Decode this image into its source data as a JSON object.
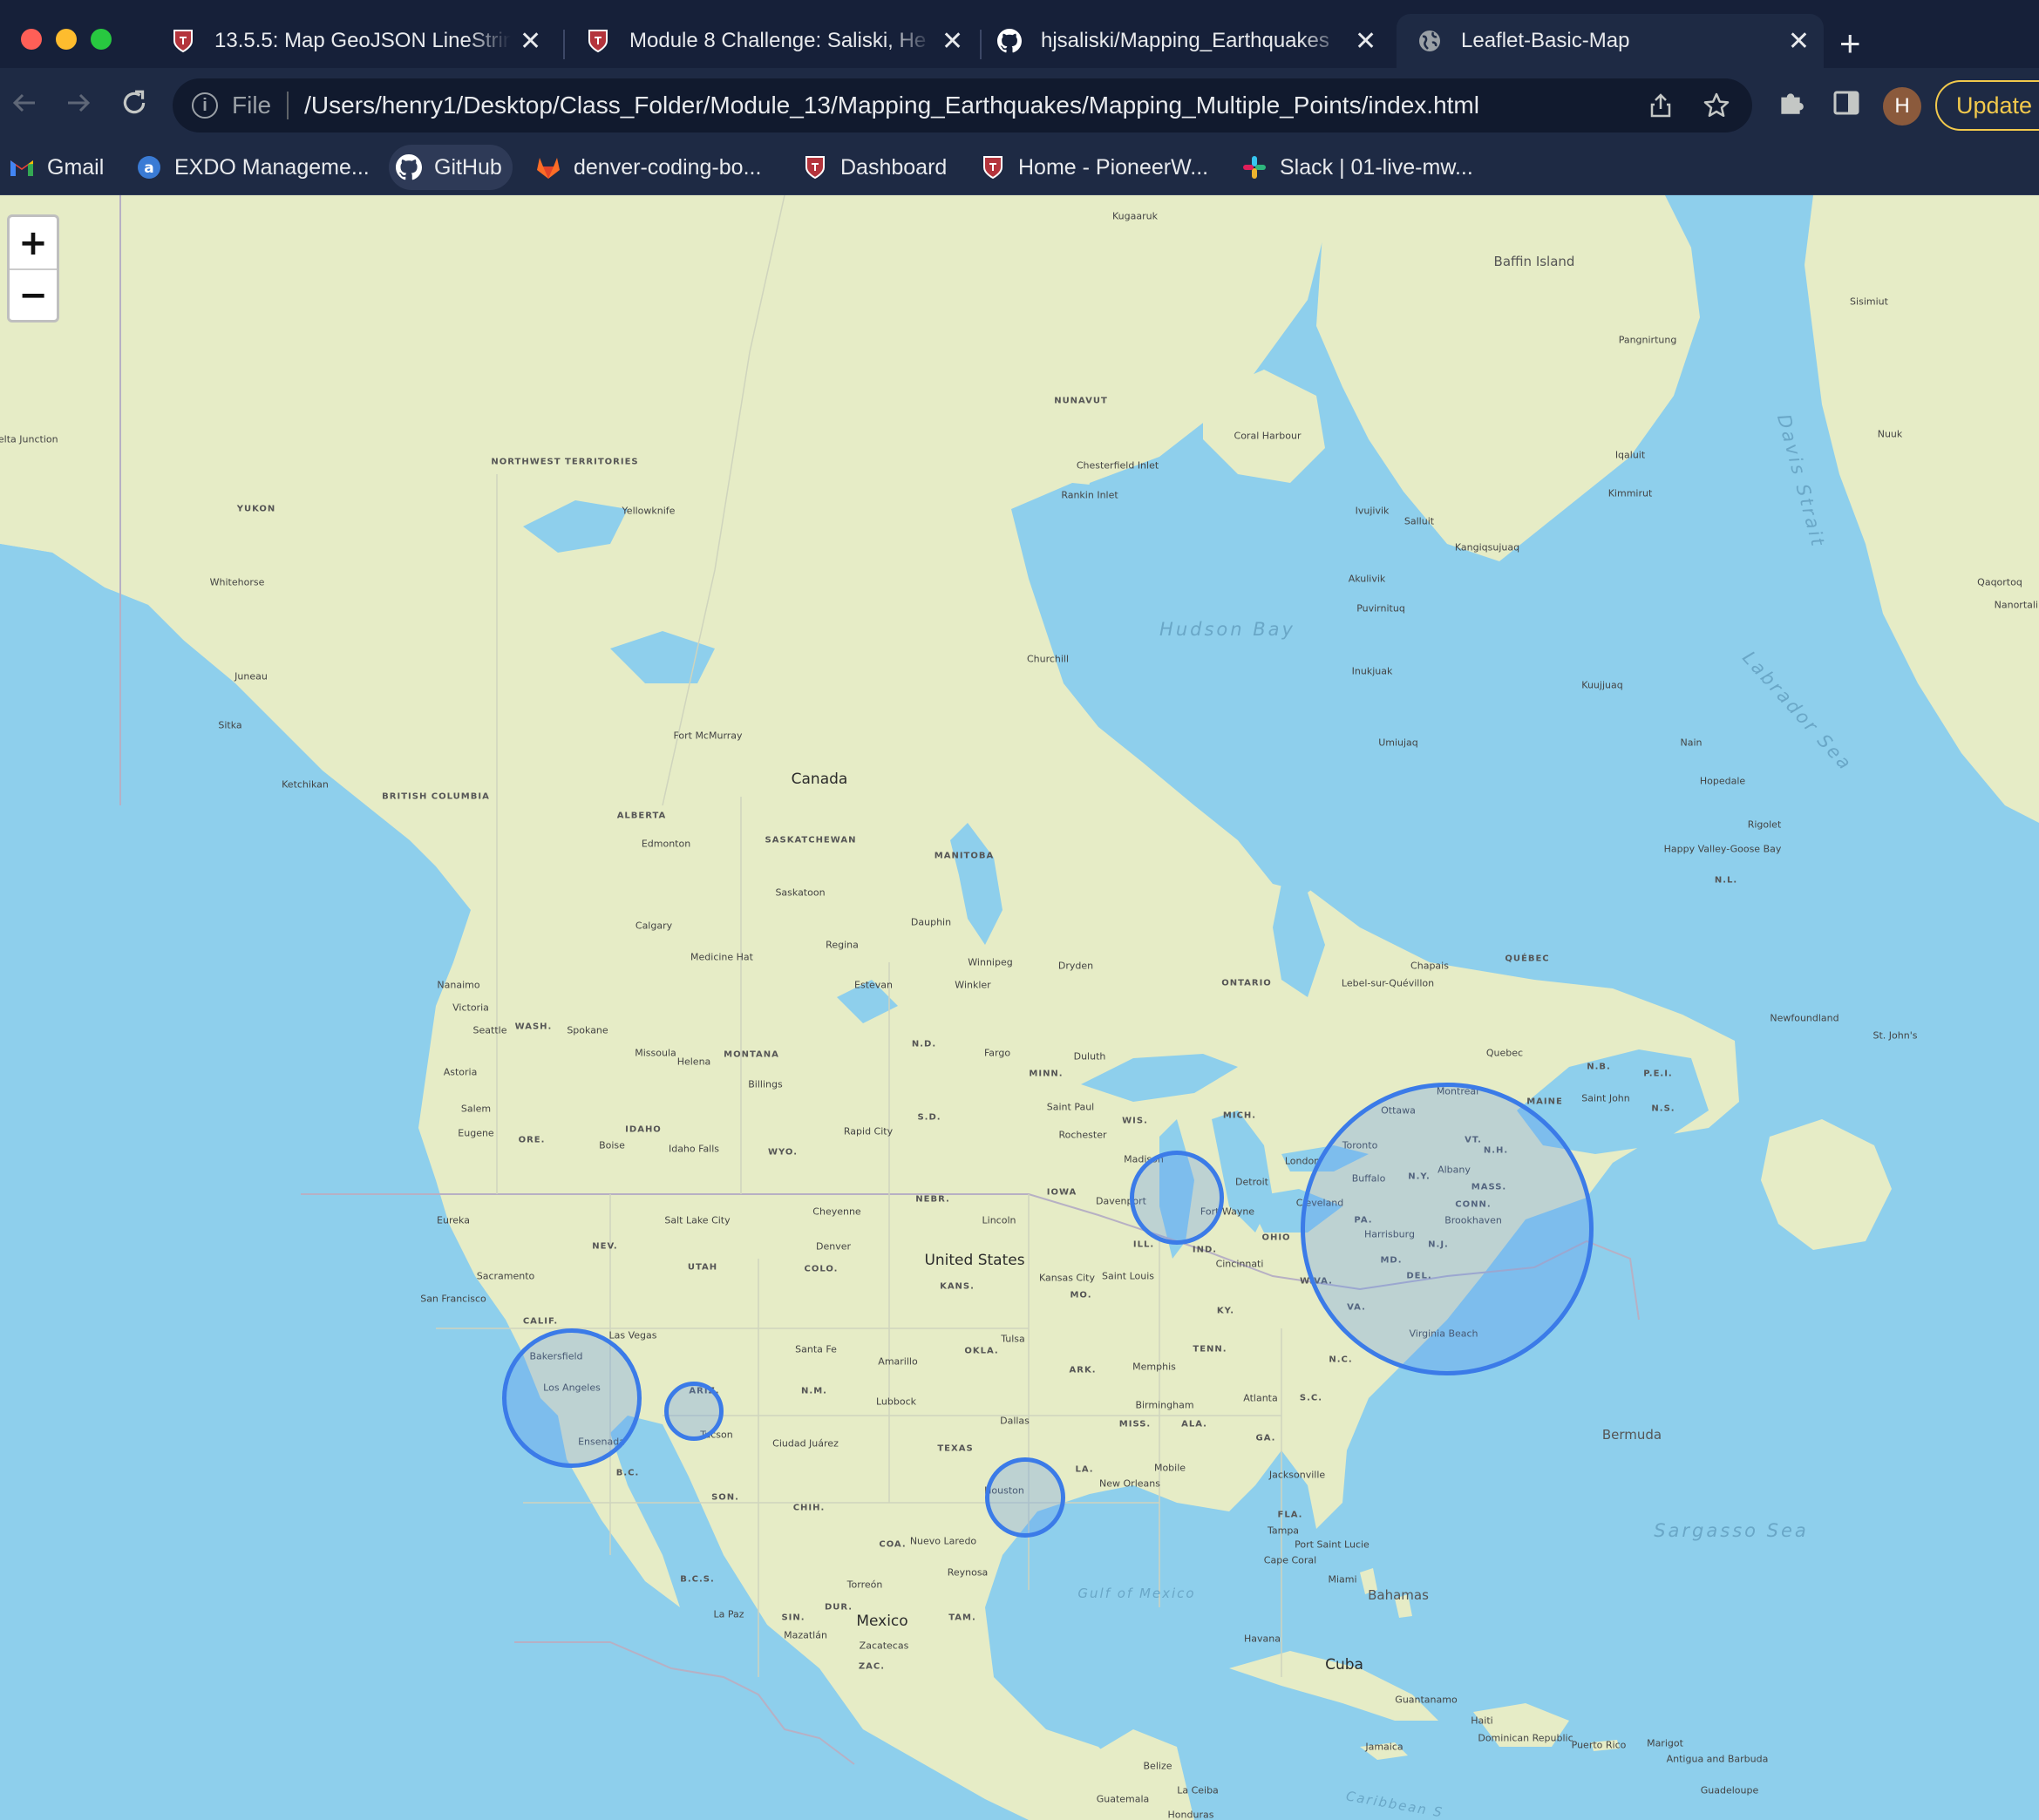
{
  "browser": {
    "tabs": [
      {
        "title": "13.5.5: Map GeoJSON LineStrin",
        "icon": "canvas-shield-icon",
        "active": false
      },
      {
        "title": "Module 8 Challenge: Saliski, He",
        "icon": "canvas-shield-icon",
        "active": false
      },
      {
        "title": "hjsaliski/Mapping_Earthquakes",
        "icon": "github-icon",
        "active": false
      },
      {
        "title": "Leaflet-Basic-Map",
        "icon": "globe-icon",
        "active": true
      }
    ],
    "close_glyph": "✕",
    "new_tab_glyph": "+",
    "omnibox": {
      "scheme_label": "File",
      "url": "/Users/henry1/Desktop/Class_Folder/Module_13/Mapping_Earthquakes/Mapping_Multiple_Points/index.html"
    },
    "profile_initial": "H",
    "update_label": "Update",
    "bookmarks": [
      {
        "label": "Gmail",
        "icon": "gmail-icon"
      },
      {
        "label": "EXDO Manageme...",
        "icon": "exdo-icon"
      },
      {
        "label": "GitHub",
        "icon": "github-icon"
      },
      {
        "label": "denver-coding-bo...",
        "icon": "gitlab-icon"
      },
      {
        "label": "Dashboard",
        "icon": "canvas-shield-icon"
      },
      {
        "label": "Home - PioneerW...",
        "icon": "canvas-shield-icon"
      },
      {
        "label": "Slack | 01-live-mw...",
        "icon": "slack-icon"
      }
    ],
    "colors": {
      "tabstrip": "#162039",
      "toolbar": "#1e2a44",
      "update_accent": "#f2c94c"
    }
  },
  "map": {
    "zoom_in_label": "+",
    "zoom_out_label": "−",
    "colors": {
      "water": "#8ecfec",
      "land": "#e6ecc6",
      "marker_stroke": "#3b7be8",
      "marker_fill": "rgba(82,143,240,0.28)"
    },
    "circle_markers": [
      {
        "name": "Los Angeles"
      },
      {
        "name": "Arizona"
      },
      {
        "name": "Chicago"
      },
      {
        "name": "Houston"
      },
      {
        "name": "East Coast"
      }
    ],
    "labels": {
      "countries": [
        "Canada",
        "United States",
        "Mexico",
        "Cuba"
      ],
      "islands": [
        "Baffin Island",
        "Bermuda",
        "Bahamas"
      ],
      "water": [
        "Hudson Bay",
        "Davis Strait",
        "Labrador Sea",
        "Sargasso Sea",
        "Gulf of Mexico",
        "Caribbean S"
      ],
      "regions": [
        "NORTHWEST TERRITORIES",
        "YUKON",
        "NUNAVUT",
        "BRITISH COLUMBIA",
        "ALBERTA",
        "SASKATCHEWAN",
        "MANITOBA",
        "ONTARIO",
        "QUÉBEC",
        "WASH.",
        "ORE.",
        "CALIF.",
        "NEV.",
        "IDAHO",
        "MONTANA",
        "WYO.",
        "UTAH",
        "ARIZ.",
        "COLO.",
        "N.M.",
        "TEXAS",
        "N.D.",
        "S.D.",
        "NEBR.",
        "KANS.",
        "OKLA.",
        "MINN.",
        "IOWA",
        "MO.",
        "ARK.",
        "LA.",
        "WIS.",
        "ILL.",
        "MICH.",
        "IND.",
        "OHIO",
        "KY.",
        "TENN.",
        "MISS.",
        "ALA.",
        "GA.",
        "FLA.",
        "S.C.",
        "N.C.",
        "VA.",
        "W.VA.",
        "PA.",
        "N.Y.",
        "VT.",
        "N.H.",
        "MAINE",
        "MASS.",
        "CONN.",
        "N.J.",
        "DEL.",
        "MD.",
        "N.B.",
        "N.S.",
        "P.E.I.",
        "N.L.",
        "B.C.",
        "SON.",
        "CHIH.",
        "COA.",
        "B.C.S.",
        "DUR.",
        "SIN.",
        "ZAC.",
        "TAM."
      ],
      "cities": [
        "Kugaaruk",
        "Baffin Island",
        "Sisimiut",
        "Pangnirtung",
        "Coral Harbour",
        "Chesterfield Inlet",
        "Rankin Inlet",
        "Iqaluit",
        "Kimmirut",
        "Delta Junction",
        "Yellowknife",
        "Whitehorse",
        "Juneau",
        "Sitka",
        "Ketchikan",
        "Churchill",
        "Fort McMurray",
        "Edmonton",
        "Calgary",
        "Saskatoon",
        "Regina",
        "Dauphin",
        "Winnipeg",
        "Dryden",
        "Medicine Hat",
        "Estevan",
        "Winkler",
        "Nanaimo",
        "Victoria",
        "Seattle",
        "Spokane",
        "Missoula",
        "Helena",
        "Billings",
        "Astoria",
        "Salem",
        "Eugene",
        "Boise",
        "Idaho Falls",
        "Rapid City",
        "Fargo",
        "Duluth",
        "Saint Paul",
        "Rochester",
        "Madison",
        "Davenport",
        "Lincoln",
        "Denver",
        "Cheyenne",
        "Salt Lake City",
        "Eureka",
        "Sacramento",
        "San Francisco",
        "Las Vegas",
        "Bakersfield",
        "Los Angeles",
        "Ensenada",
        "Tucson",
        "Santa Fe",
        "Amarillo",
        "Lubbock",
        "Ciudad Juárez",
        "Dallas",
        "Houston",
        "Tulsa",
        "Kansas City",
        "Saint Louis",
        "Memphis",
        "Birmingham",
        "Atlanta",
        "New Orleans",
        "Mobile",
        "Jacksonville",
        "Tampa",
        "Cape Coral",
        "Miami",
        "Port Saint Lucie",
        "Cincinnati",
        "Fort Wayne",
        "Detroit",
        "Cleveland",
        "London",
        "Toronto",
        "Buffalo",
        "Ottawa",
        "Montreal",
        "Quebec",
        "Albany",
        "Harrisburg",
        "Brookhaven",
        "Virginia Beach",
        "Chapais",
        "Lebel-sur-Quévillon",
        "Saint John",
        "Newfoundland",
        "St. John's",
        "Hopedale",
        "Nain",
        "Rigolet",
        "Happy Valley-Goose Bay",
        "Kuujjuaq",
        "Umiujaq",
        "Inukjuak",
        "Akulivik",
        "Puvirnituq",
        "Ivujivik",
        "Salluit",
        "Kangiqsujuaq",
        "Nuuk",
        "Qaqortoq",
        "Nanortalik",
        "Nuevo Laredo",
        "Reynosa",
        "Torreón",
        "Mazatlán",
        "La Paz",
        "Zacatecas",
        "Havana",
        "Guantanamo",
        "Haiti",
        "Dominican Republic",
        "Puerto Rico",
        "Jamaica",
        "Belize",
        "Guatemala",
        "Honduras",
        "La Ceiba",
        "Antigua and Barbuda",
        "Guadeloupe",
        "Marigot"
      ]
    }
  }
}
